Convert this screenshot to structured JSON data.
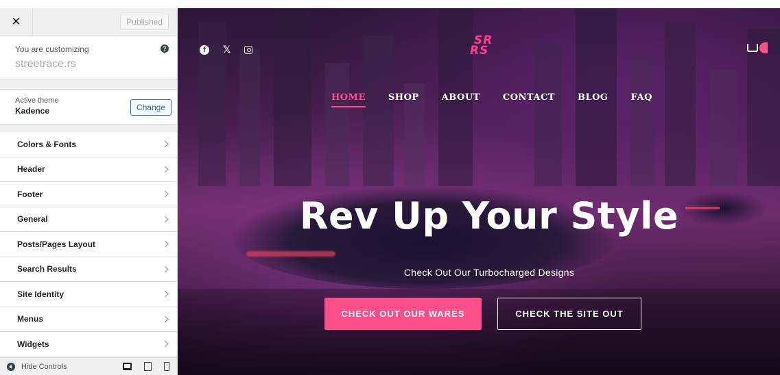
{
  "customizer": {
    "close_symbol": "✕",
    "published_label": "Published",
    "customizing_label": "You are customizing",
    "site_name": "streetrace.rs",
    "help_symbol": "?",
    "active_theme_label": "Active theme",
    "theme_name": "Kadence",
    "change_label": "Change",
    "menu_items": [
      {
        "label": "Colors & Fonts"
      },
      {
        "label": "Header"
      },
      {
        "label": "Footer"
      },
      {
        "label": "General"
      },
      {
        "label": "Posts/Pages Layout"
      },
      {
        "label": "Search Results"
      },
      {
        "label": "Site Identity"
      },
      {
        "label": "Menus"
      },
      {
        "label": "Widgets"
      }
    ],
    "hide_controls_label": "Hide Controls"
  },
  "preview": {
    "social": {
      "facebook": "f",
      "x": "𝕏"
    },
    "logo": {
      "line1": "SR",
      "line2": "RS"
    },
    "nav": [
      "HOME",
      "SHOP",
      "ABOUT",
      "CONTACT",
      "BLOG",
      "FAQ"
    ],
    "hero_title": "Rev Up Your Style",
    "hero_subtitle": "Check Out Our Turbocharged Designs",
    "primary_button": "CHECK OUT OUR WARES",
    "secondary_button": "CHECK THE SITE OUT"
  },
  "colors": {
    "accent_pink": "#ff4f8b",
    "wp_blue": "#2271b1",
    "sidebar_bg": "#f0f0f1"
  },
  "icons": [
    "close-icon",
    "help-icon",
    "chevron-right-icon",
    "hide-controls-icon",
    "desktop-icon",
    "tablet-icon",
    "mobile-icon",
    "facebook-icon",
    "x-icon",
    "instagram-icon",
    "cart-icon"
  ]
}
